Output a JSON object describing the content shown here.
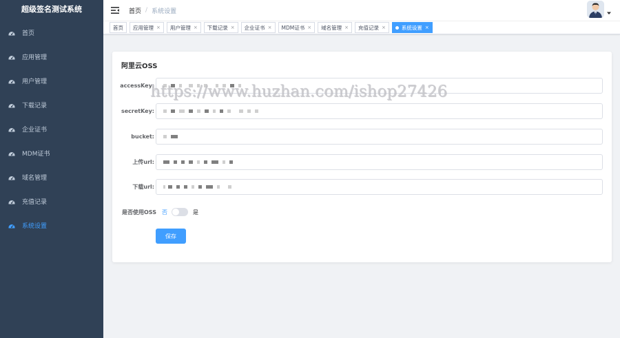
{
  "sidebar": {
    "title": "超级签名测试系统",
    "items": [
      {
        "label": "首页",
        "icon": "dashboard-icon",
        "active": false
      },
      {
        "label": "应用管理",
        "icon": "dashboard-icon",
        "active": false
      },
      {
        "label": "用户管理",
        "icon": "dashboard-icon",
        "active": false
      },
      {
        "label": "下载记录",
        "icon": "dashboard-icon",
        "active": false
      },
      {
        "label": "企业证书",
        "icon": "dashboard-icon",
        "active": false
      },
      {
        "label": "MDM证书",
        "icon": "dashboard-icon",
        "active": false
      },
      {
        "label": "域名管理",
        "icon": "dashboard-icon",
        "active": false
      },
      {
        "label": "充值记录",
        "icon": "dashboard-icon",
        "active": false
      },
      {
        "label": "系统设置",
        "icon": "dashboard-icon",
        "active": true
      }
    ]
  },
  "navbar": {
    "breadcrumb": {
      "home": "首页",
      "separator": "/",
      "current": "系统设置"
    }
  },
  "tags": [
    {
      "label": "首页",
      "closable": false,
      "active": false
    },
    {
      "label": "应用管理",
      "closable": true,
      "active": false
    },
    {
      "label": "用户管理",
      "closable": true,
      "active": false
    },
    {
      "label": "下载记录",
      "closable": true,
      "active": false
    },
    {
      "label": "企业证书",
      "closable": true,
      "active": false
    },
    {
      "label": "MDM证书",
      "closable": true,
      "active": false
    },
    {
      "label": "域名管理",
      "closable": true,
      "active": false
    },
    {
      "label": "充值记录",
      "closable": true,
      "active": false
    },
    {
      "label": "系统设置",
      "closable": true,
      "active": true
    }
  ],
  "form": {
    "title": "阿里云OSS",
    "fields": [
      {
        "label": "accessKey:",
        "name": "accesskey"
      },
      {
        "label": "secretKey:",
        "name": "secretkey"
      },
      {
        "label": "bucket:",
        "name": "bucket"
      },
      {
        "label": "上传url:",
        "name": "upload-url"
      },
      {
        "label": "下载url:",
        "name": "download-url"
      }
    ],
    "switch": {
      "label": "是否使用OSS",
      "off_text": "否",
      "on_text": "是",
      "value": false
    },
    "save_label": "保存"
  },
  "watermark": "https://www.huzhan.com/ishop27426",
  "colors": {
    "sidebar_bg": "#304156",
    "sidebar_text": "#bfcbd9",
    "accent": "#409eff",
    "page_bg": "#f0f2f5"
  }
}
